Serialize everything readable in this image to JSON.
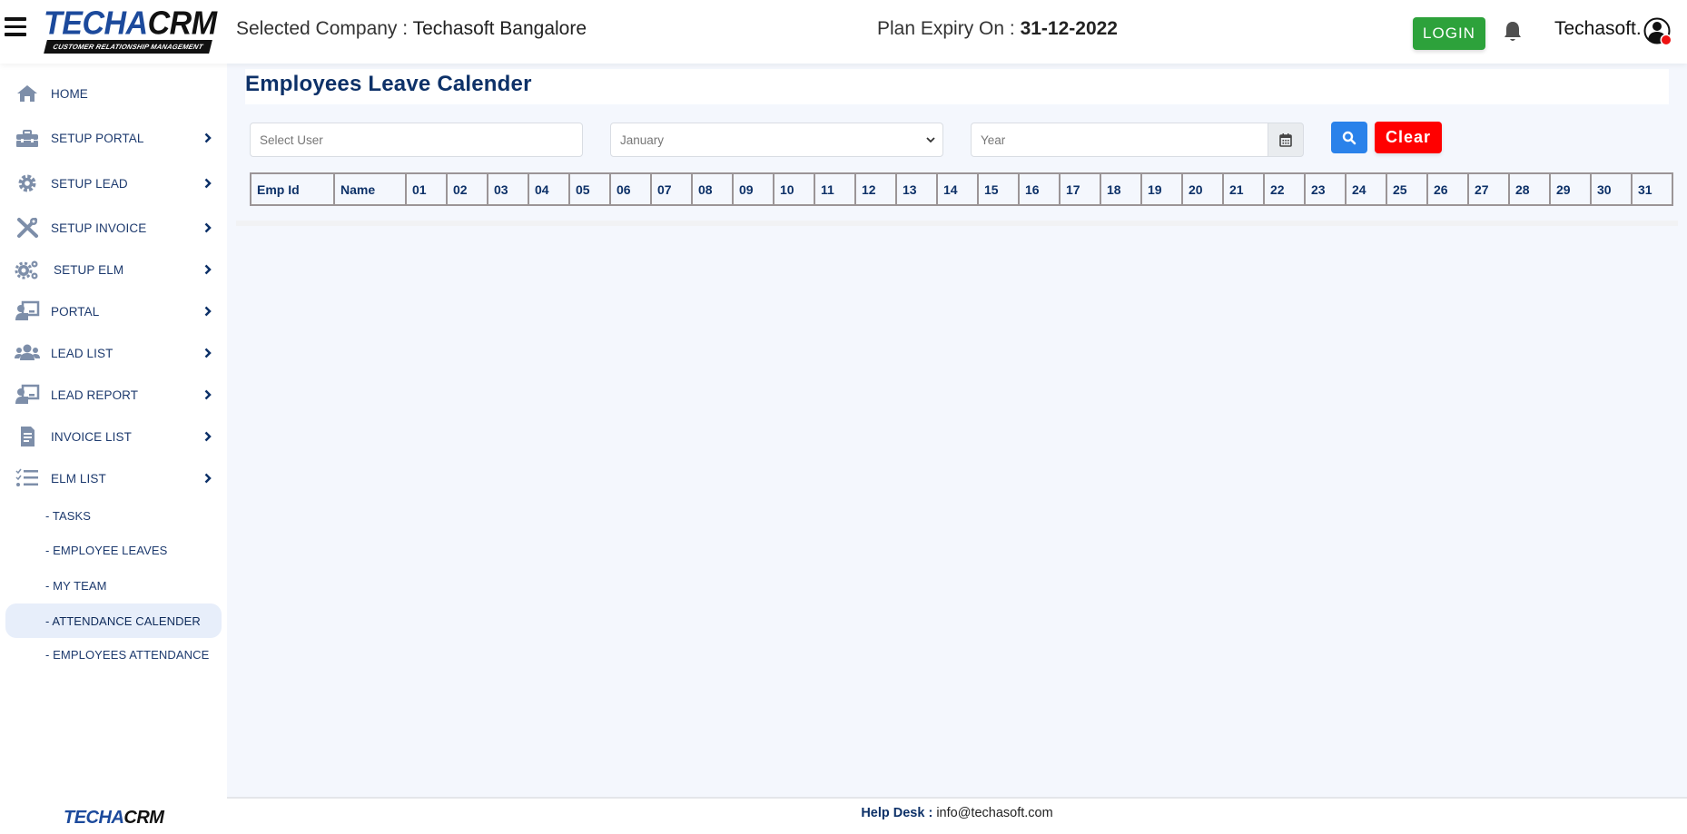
{
  "header": {
    "logo_main": "TECHA",
    "logo_accent": "CRM",
    "logo_tagline": "CUSTOMER RELATIONSHIP MANAGEMENT",
    "company_label": "Selected Company : ",
    "company_name": "Techasoft Bangalore",
    "expiry_label": "Plan Expiry On : ",
    "expiry_date": "31-12-2022",
    "login_label": "LOGIN",
    "username": "Techasoft.",
    "colors": {
      "login_bg": "#2da23b",
      "brand_blue": "#1c4a9c"
    }
  },
  "sidebar": {
    "items": [
      {
        "label": "HOME",
        "icon": "home-icon",
        "has_chevron": false
      },
      {
        "label": "SETUP PORTAL",
        "icon": "toolbox-icon",
        "has_chevron": true
      },
      {
        "label": "SETUP LEAD",
        "icon": "gear-icon",
        "has_chevron": true
      },
      {
        "label": "SETUP INVOICE",
        "icon": "tools-icon",
        "has_chevron": true
      },
      {
        "label": "SETUP ELM",
        "icon": "gears-icon",
        "has_chevron": true
      },
      {
        "label": "PORTAL",
        "icon": "presenter-icon",
        "has_chevron": true
      },
      {
        "label": "LEAD LIST",
        "icon": "users-icon",
        "has_chevron": true
      },
      {
        "label": "LEAD REPORT",
        "icon": "presenter-icon",
        "has_chevron": true
      },
      {
        "label": "INVOICE LIST",
        "icon": "document-icon",
        "has_chevron": true
      },
      {
        "label": "ELM LIST",
        "icon": "checklist-icon",
        "has_chevron": true
      }
    ],
    "subitems": [
      {
        "label": "- TASKS",
        "active": false
      },
      {
        "label": "- EMPLOYEE LEAVES",
        "active": false
      },
      {
        "label": "- MY TEAM",
        "active": false
      },
      {
        "label": "- ATTENDANCE CALENDER",
        "active": true
      },
      {
        "label": "- EMPLOYEES ATTENDANCE",
        "active": false
      }
    ],
    "footer_logo_main": "TECHA",
    "footer_logo_accent": "CRM"
  },
  "main": {
    "title": "Employees Leave Calender",
    "filters": {
      "user_placeholder": "Select User",
      "month_value": "January",
      "year_placeholder": "Year",
      "clear_label": "Clear"
    },
    "table": {
      "headers": [
        "Emp Id",
        "Name",
        "01",
        "02",
        "03",
        "04",
        "05",
        "06",
        "07",
        "08",
        "09",
        "10",
        "11",
        "12",
        "13",
        "14",
        "15",
        "16",
        "17",
        "18",
        "19",
        "20",
        "21",
        "22",
        "23",
        "24",
        "25",
        "26",
        "27",
        "28",
        "29",
        "30",
        "31"
      ],
      "rows": []
    }
  },
  "footer": {
    "helpdesk_label": "Help Desk :",
    "helpdesk_email": " info@techasoft.com"
  }
}
